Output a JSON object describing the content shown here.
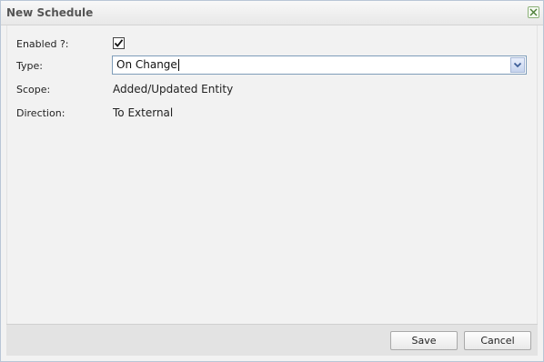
{
  "dialog": {
    "title": "New Schedule"
  },
  "form": {
    "enabled": {
      "label": "Enabled ?:",
      "checked": true
    },
    "type": {
      "label": "Type:",
      "value": "On Change"
    },
    "scope": {
      "label": "Scope:",
      "value": "Added/Updated Entity"
    },
    "direction": {
      "label": "Direction:",
      "value": "To External"
    }
  },
  "footer": {
    "save_label": "Save",
    "cancel_label": "Cancel"
  },
  "icons": {
    "close": "close-icon",
    "check": "checkmark-icon",
    "dropdown": "chevron-down-icon"
  }
}
